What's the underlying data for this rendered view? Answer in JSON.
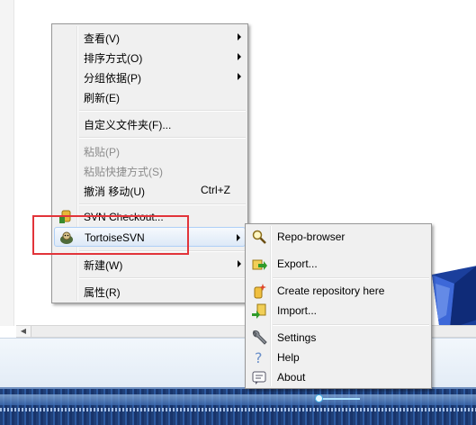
{
  "main_menu": {
    "items": [
      {
        "label": "查看(V)"
      },
      {
        "label": "排序方式(O)"
      },
      {
        "label": "分组依据(P)"
      },
      {
        "label": "刷新(E)"
      },
      {
        "label": "自定义文件夹(F)..."
      },
      {
        "label": "粘贴(P)"
      },
      {
        "label": "粘贴快捷方式(S)"
      },
      {
        "label": "撤消 移动(U)",
        "accel": "Ctrl+Z"
      },
      {
        "label": "SVN Checkout..."
      },
      {
        "label": "TortoiseSVN"
      },
      {
        "label": "新建(W)"
      },
      {
        "label": "属性(R)"
      }
    ]
  },
  "submenu": {
    "items": [
      {
        "label": "Repo-browser"
      },
      {
        "label": "Export..."
      },
      {
        "label": "Create repository here"
      },
      {
        "label": "Import..."
      },
      {
        "label": "Settings"
      },
      {
        "label": "Help"
      },
      {
        "label": "About"
      }
    ]
  },
  "icons": {
    "svn_checkout": "svn-checkout-icon",
    "tortoisesvn": "tortoise-icon",
    "repo_browser": "magnifier-icon",
    "export": "export-icon",
    "create_repo": "create-repo-icon",
    "import": "import-icon",
    "settings": "wrench-icon",
    "help": "help-icon",
    "about": "about-icon"
  },
  "colors": {
    "highlight_annotation": "#e2343a",
    "menu_background": "#f0f0f0",
    "selection_border": "#aecff7"
  }
}
